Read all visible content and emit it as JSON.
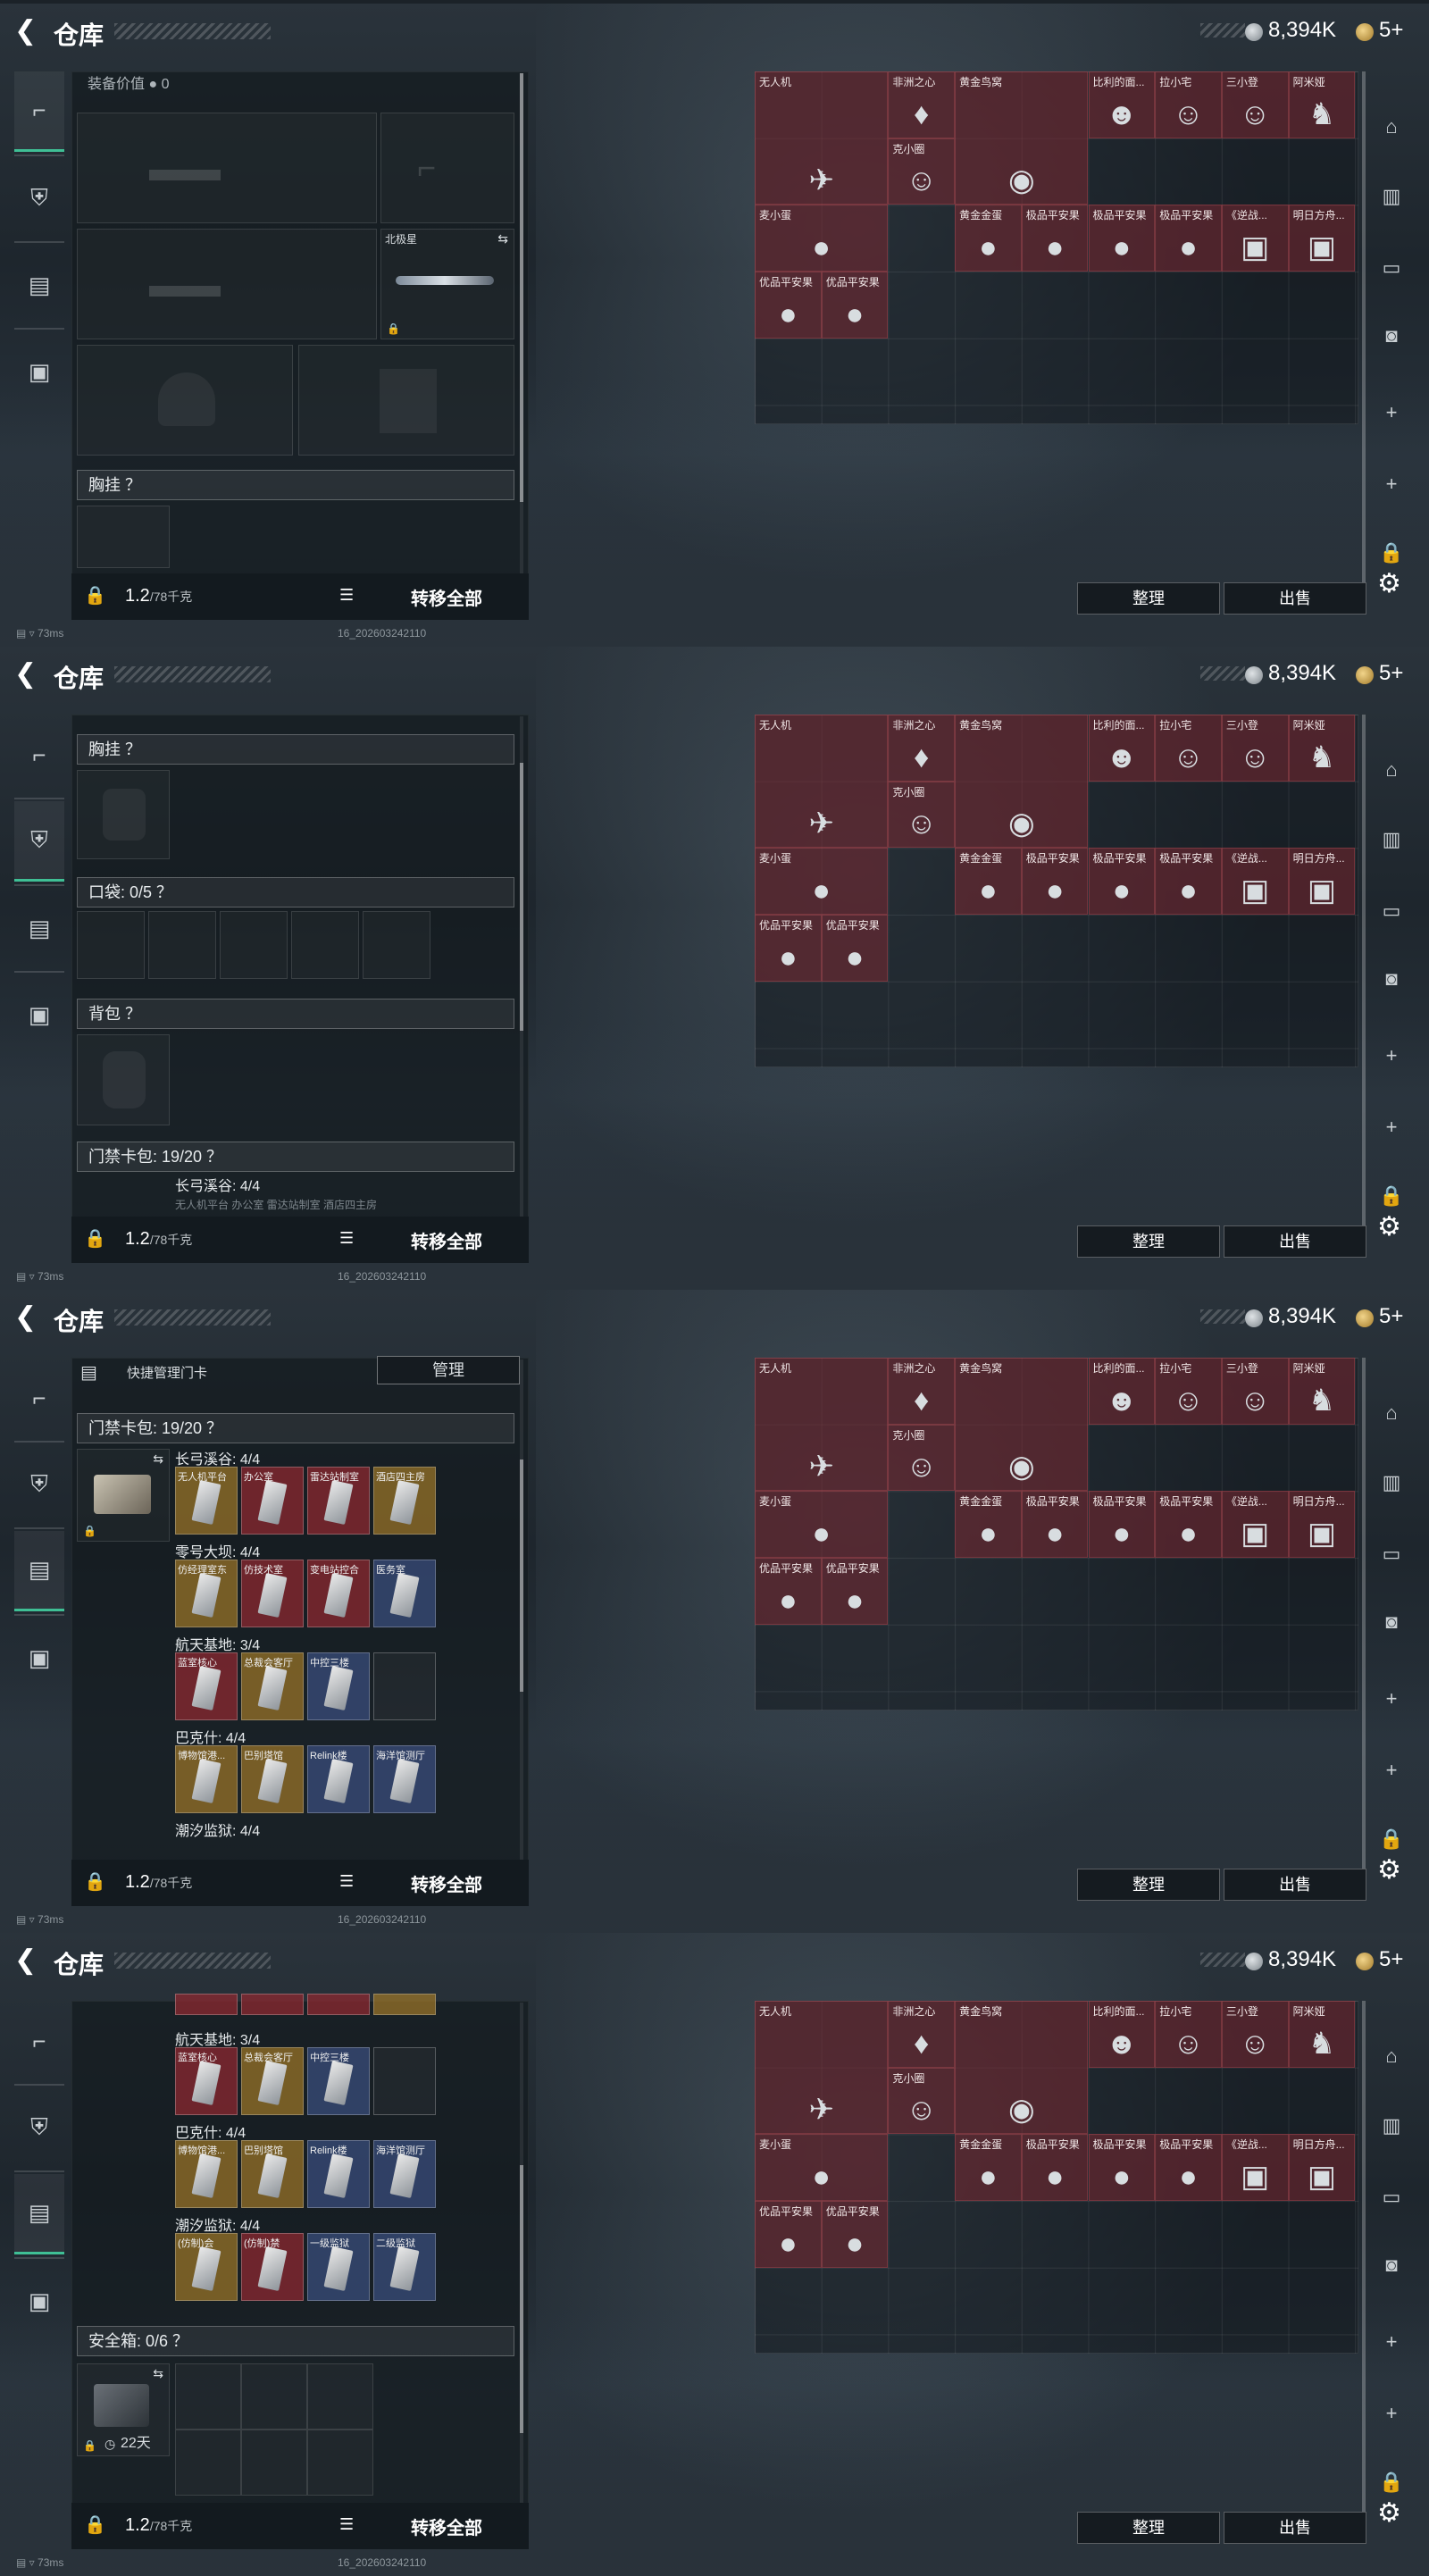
{
  "topbar": {
    "back_icon": "back-arrow-icon",
    "title": "仓库",
    "silver_value": "8,394K",
    "gold_value": "5+"
  },
  "bottombar": {
    "weight_current": "1.2",
    "weight_max": "/78千克",
    "transfer_all": "转移全部"
  },
  "stash": {
    "sort_label": "整理",
    "sell_label": "出售",
    "items": [
      {
        "name": "无人机",
        "icon": "drone-icon",
        "glyph": "✈"
      },
      {
        "name": "非洲之心",
        "icon": "diamond-icon",
        "glyph": "♦"
      },
      {
        "name": "克小圈",
        "icon": "figurine-icon",
        "glyph": "☺"
      },
      {
        "name": "黄金鸟窝",
        "icon": "golden-nest-icon",
        "glyph": "◉"
      },
      {
        "name": "比利的面...",
        "icon": "mask-icon",
        "glyph": "☻"
      },
      {
        "name": "拉小宅",
        "icon": "figurine-icon",
        "glyph": "☺"
      },
      {
        "name": "三小登",
        "icon": "figurine-icon",
        "glyph": "☺"
      },
      {
        "name": "阿米娅",
        "icon": "bunny-figurine-icon",
        "glyph": "♞"
      },
      {
        "name": "麦小蛋",
        "icon": "egg-toy-icon",
        "glyph": "●"
      },
      {
        "name": "黄金金蛋",
        "icon": "golden-egg-icon",
        "glyph": "●"
      },
      {
        "name": "极品平安果",
        "icon": "apple-icon",
        "glyph": "●"
      },
      {
        "name": "极品平安果",
        "icon": "apple-icon",
        "glyph": "●"
      },
      {
        "name": "极品平安果",
        "icon": "apple-icon",
        "glyph": "●"
      },
      {
        "name": "《逆战...",
        "icon": "card-icon",
        "glyph": "▣"
      },
      {
        "name": "明日方舟...",
        "icon": "card-icon",
        "glyph": "▣"
      },
      {
        "name": "优品平安果",
        "icon": "apple-icon",
        "glyph": "●"
      },
      {
        "name": "优品平安果",
        "icon": "apple-icon",
        "glyph": "●"
      }
    ]
  },
  "footer": {
    "ping": "73ms",
    "build": "16_202603242110"
  },
  "frame1": {
    "equip_value_label": "装备价值",
    "equip_value": "0",
    "pistol_label": "北极星",
    "chest_label": "胸挂 ？"
  },
  "frame2": {
    "chest_label": "胸挂 ？",
    "pocket_label": "口袋: 0/5 ？",
    "backpack_label": "背包 ？",
    "keycard_label": "门禁卡包: 19/20 ？",
    "first_group": "长弓溪谷: 4/4",
    "first_cards": "无人机平台 办公室 雷达站制室 酒店四主房"
  },
  "frame3": {
    "quick_manage": "快捷管理门卡",
    "manage_btn": "管理",
    "keycard_label": "门禁卡包: 19/20 ？",
    "groups": [
      {
        "name": "长弓溪谷: 4/4",
        "cards": [
          {
            "l": "无人机平台",
            "c": "yel"
          },
          {
            "l": "办公室",
            "c": "red"
          },
          {
            "l": "雷达站制室",
            "c": "red"
          },
          {
            "l": "酒店四主房",
            "c": "yel"
          }
        ]
      },
      {
        "name": "零号大坝: 4/4",
        "cards": [
          {
            "l": "仿经理室东",
            "c": "yel"
          },
          {
            "l": "仿技术室",
            "c": "red"
          },
          {
            "l": "变电站控合",
            "c": "red"
          },
          {
            "l": "医务室",
            "c": "blu"
          }
        ]
      },
      {
        "name": "航天基地: 3/4",
        "cards": [
          {
            "l": "蓝室核心",
            "c": "red"
          },
          {
            "l": "总裁会客厅",
            "c": "yel"
          },
          {
            "l": "中控三楼",
            "c": "blu"
          },
          {
            "l": "",
            "c": "dk"
          }
        ]
      },
      {
        "name": "巴克什: 4/4",
        "cards": [
          {
            "l": "博物馆港...",
            "c": "yel"
          },
          {
            "l": "巴别塔馆",
            "c": "yel"
          },
          {
            "l": "Relink楼",
            "c": "blu"
          },
          {
            "l": "海洋馆测厅",
            "c": "blu"
          }
        ]
      },
      {
        "name": "潮汐监狱: 4/4",
        "cards": [
          {
            "l": "(仿制)会",
            "c": "yel"
          },
          {
            "l": "(仿制)禁",
            "c": "red"
          },
          {
            "l": "一级监狱",
            "c": "blu"
          },
          {
            "l": "二级监狱",
            "c": "blu"
          }
        ]
      }
    ]
  },
  "frame4": {
    "safe_label": "安全箱: 0/6 ？",
    "safe_time": "22天"
  }
}
